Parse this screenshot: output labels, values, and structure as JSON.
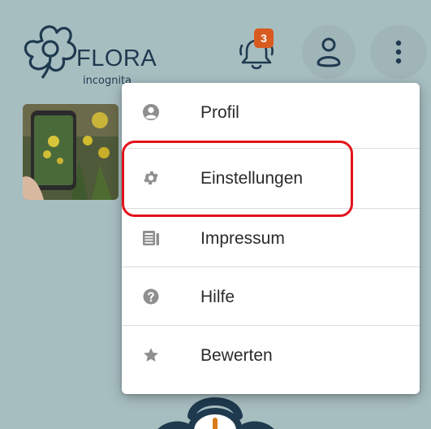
{
  "app": {
    "logo_word": "FLORA",
    "logo_sub": "incognita",
    "notification_count": "3"
  },
  "menu": {
    "items": [
      {
        "label": "Profil",
        "icon": "user-circle-icon"
      },
      {
        "label": "Einstellungen",
        "icon": "gear-icon"
      },
      {
        "label": "Impressum",
        "icon": "newspaper-icon"
      },
      {
        "label": "Hilfe",
        "icon": "help-circle-icon"
      },
      {
        "label": "Bewerten",
        "icon": "star-icon"
      }
    ]
  },
  "colors": {
    "background": "#a7bec1",
    "brand_dark": "#1f3a4f",
    "badge": "#d95a20",
    "highlight": "#e3131b",
    "menu_icon": "#8f8f8f"
  }
}
